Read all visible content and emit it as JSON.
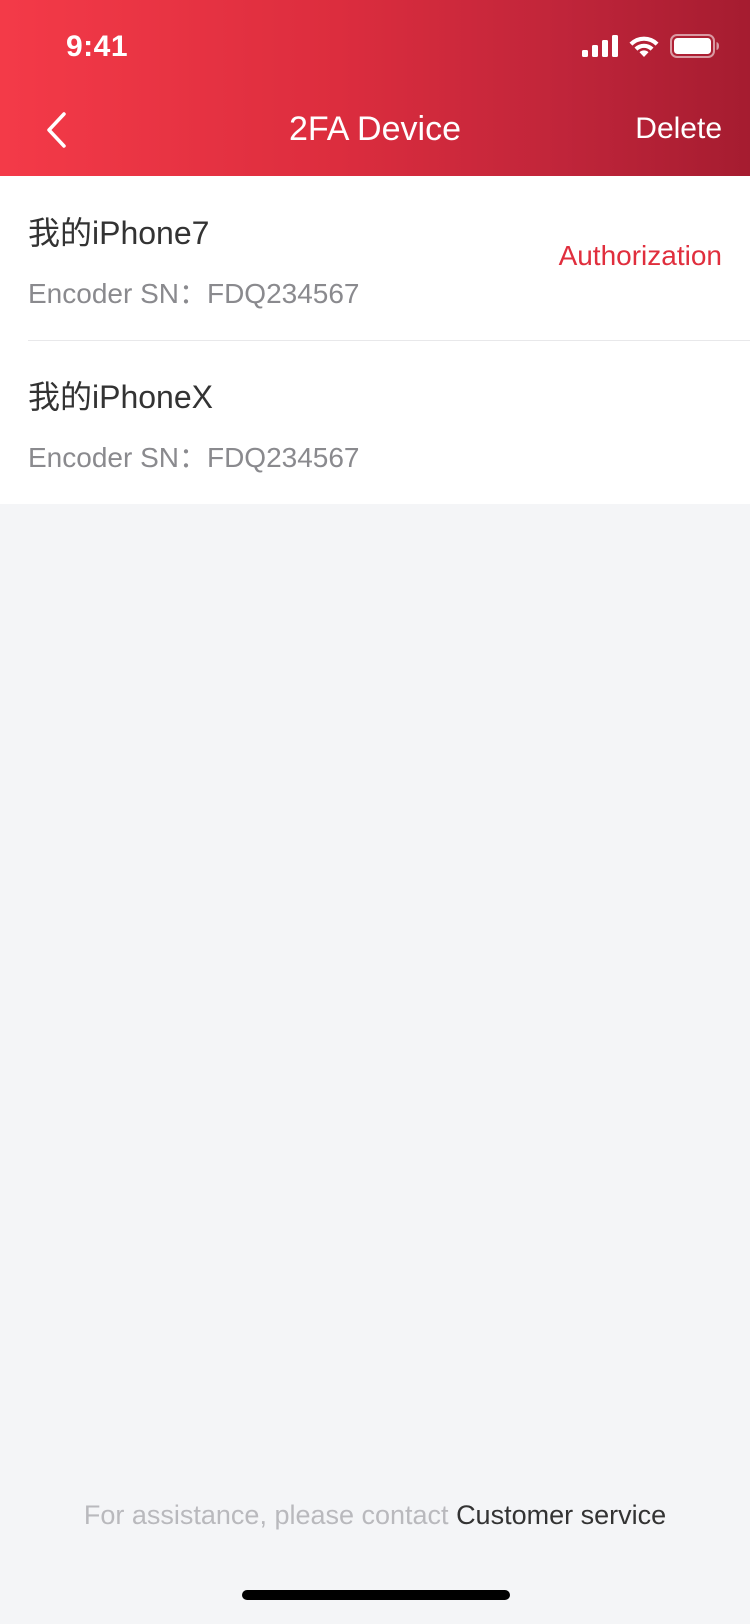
{
  "status_bar": {
    "time": "9:41",
    "icons": [
      "signal-icon",
      "wifi-icon",
      "battery-icon"
    ]
  },
  "nav": {
    "title": "2FA Device",
    "back_icon": "chevron-left-icon",
    "action_label": "Delete"
  },
  "devices": [
    {
      "name": "我的iPhone7",
      "sn_label": "Encoder SN：",
      "sn_value": "FDQ234567",
      "action": "Authorization"
    },
    {
      "name": "我的iPhoneX",
      "sn_label": "Encoder SN：",
      "sn_value": "FDQ234567",
      "action": ""
    }
  ],
  "footer": {
    "prefix": "For assistance, please contact ",
    "link": "Customer service"
  },
  "colors": {
    "header_start": "#f43a48",
    "header_end": "#a51c30",
    "accent": "#e02e3d",
    "background": "#f4f5f7"
  }
}
